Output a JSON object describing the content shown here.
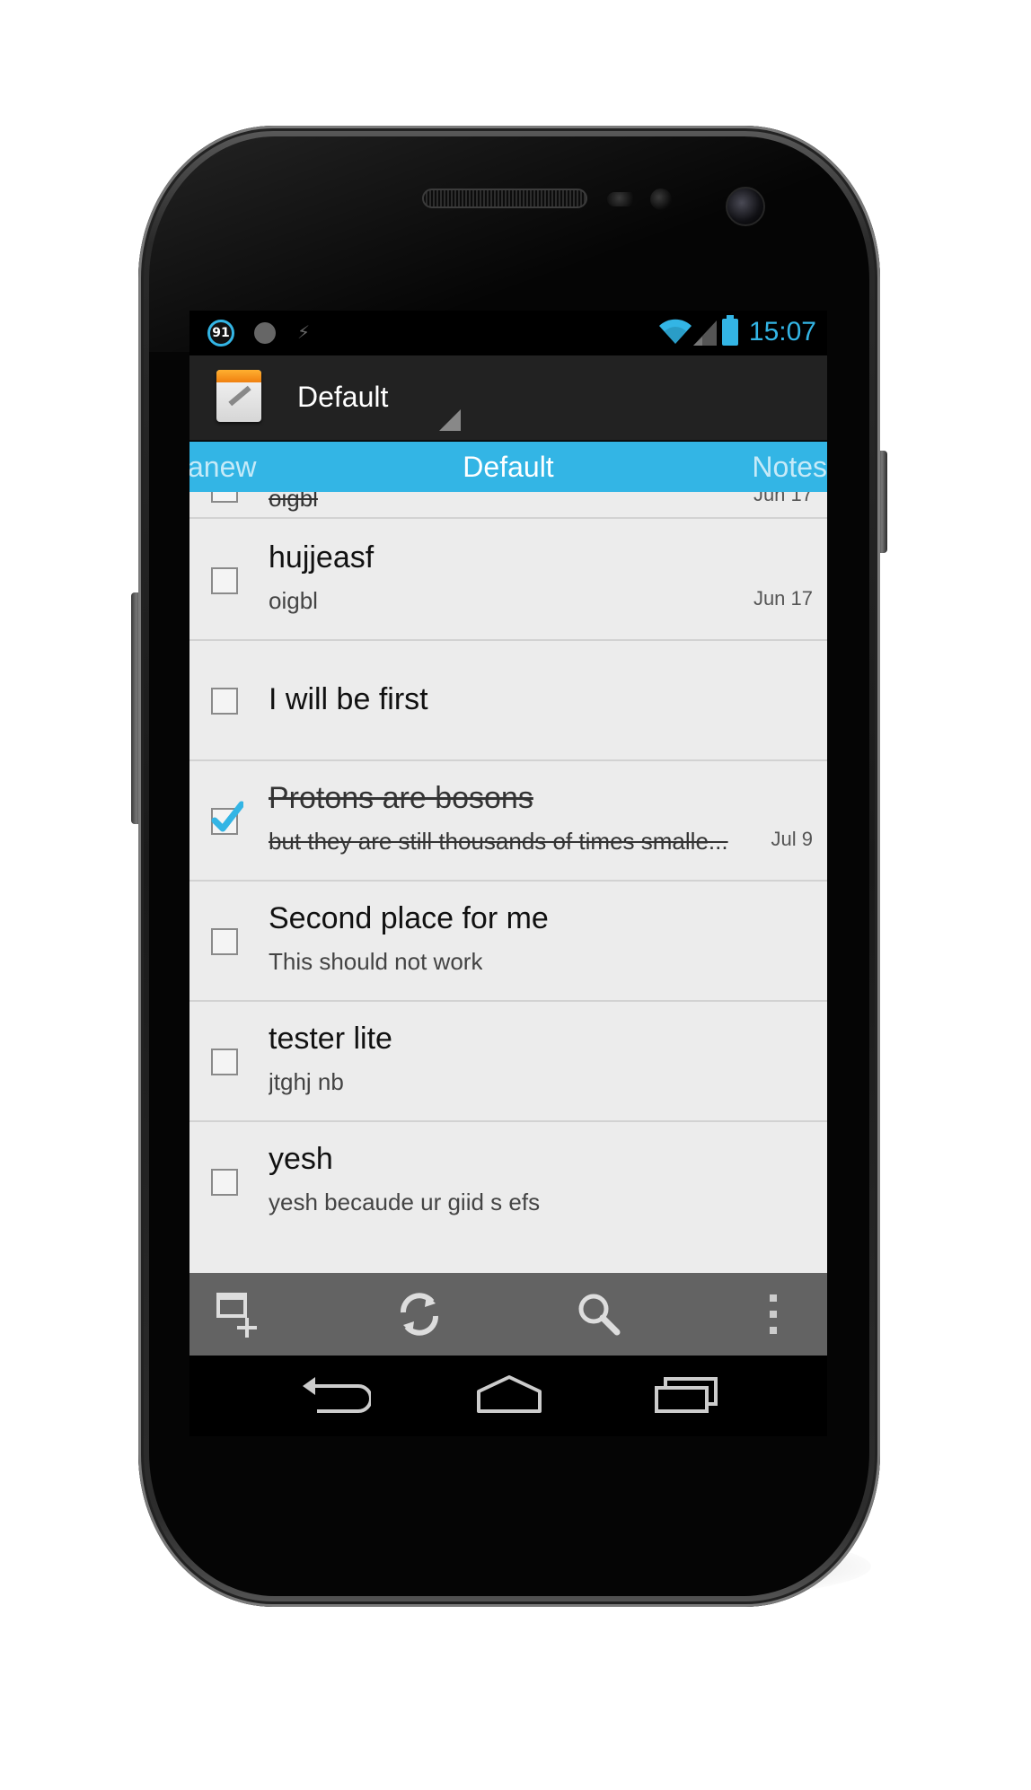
{
  "status_bar": {
    "notification_badge": "91",
    "time": "15:07"
  },
  "action_bar": {
    "title": "Default"
  },
  "tabs": {
    "previous": "anew",
    "current": "Default",
    "next": "Notes"
  },
  "tasks": [
    {
      "title": "",
      "note": "oigbl",
      "date": "Jun 17",
      "checked": true
    },
    {
      "title": "hujjeasf",
      "note": "oigbl",
      "date": "Jun 17",
      "checked": false
    },
    {
      "title": "I will be first",
      "note": "",
      "date": "",
      "checked": false
    },
    {
      "title": "Protons are bosons",
      "note": "but they are still thousands of times smalle...",
      "date": "Jul 9",
      "checked": true
    },
    {
      "title": "Second place for me",
      "note": "This should not work",
      "date": "",
      "checked": false
    },
    {
      "title": "tester lite",
      "note": "jtghj nb",
      "date": "",
      "checked": false
    },
    {
      "title": "yesh",
      "note": "yesh  becaude ur giid s efs",
      "date": "",
      "checked": false
    }
  ],
  "bottom_bar": {
    "icons": [
      "add-task-icon",
      "sync-icon",
      "search-icon",
      "overflow-menu-icon"
    ]
  },
  "nav_bar": {
    "icons": [
      "back-icon",
      "home-icon",
      "recents-icon"
    ]
  },
  "colors": {
    "accent": "#33b5e5",
    "action_bar": "#222222",
    "list_background": "#ececec",
    "bottom_bar": "#636363"
  }
}
